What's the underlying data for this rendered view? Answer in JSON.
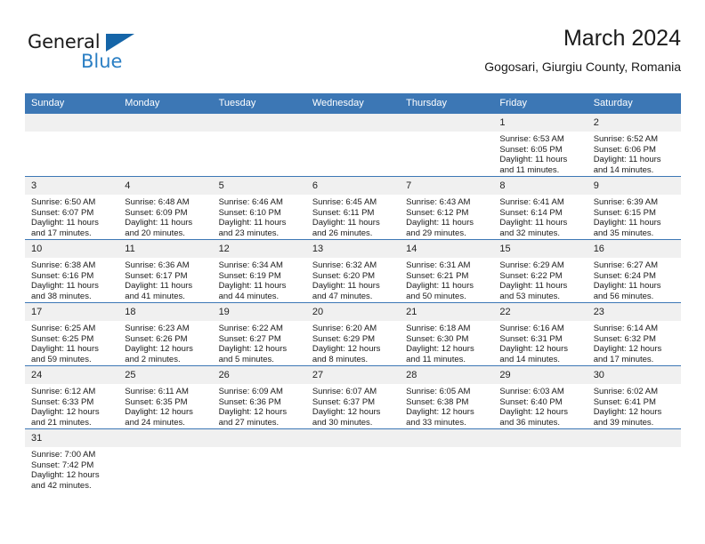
{
  "brand": {
    "name_top": "General",
    "name_bottom": "Blue",
    "accent_color": "#2b7fc4",
    "triangle_color": "#1565a8"
  },
  "header": {
    "title": "March 2024",
    "subtitle": "Gogosari, Giurgiu County, Romania"
  },
  "theme": {
    "header_bg": "#3c77b5",
    "header_text": "#ffffff",
    "daynum_bg": "#f0f0f0",
    "row_border": "#3c77b5"
  },
  "weekday_headers": [
    "Sunday",
    "Monday",
    "Tuesday",
    "Wednesday",
    "Thursday",
    "Friday",
    "Saturday"
  ],
  "labels": {
    "sunrise_prefix": "Sunrise:",
    "sunset_prefix": "Sunset:",
    "daylight_prefix": "Daylight:"
  },
  "weeks": [
    [
      {
        "day": ""
      },
      {
        "day": ""
      },
      {
        "day": ""
      },
      {
        "day": ""
      },
      {
        "day": ""
      },
      {
        "day": "1",
        "sunrise": "Sunrise: 6:53 AM",
        "sunset": "Sunset: 6:05 PM",
        "daylight1": "Daylight: 11 hours",
        "daylight2": "and 11 minutes."
      },
      {
        "day": "2",
        "sunrise": "Sunrise: 6:52 AM",
        "sunset": "Sunset: 6:06 PM",
        "daylight1": "Daylight: 11 hours",
        "daylight2": "and 14 minutes."
      }
    ],
    [
      {
        "day": "3",
        "sunrise": "Sunrise: 6:50 AM",
        "sunset": "Sunset: 6:07 PM",
        "daylight1": "Daylight: 11 hours",
        "daylight2": "and 17 minutes."
      },
      {
        "day": "4",
        "sunrise": "Sunrise: 6:48 AM",
        "sunset": "Sunset: 6:09 PM",
        "daylight1": "Daylight: 11 hours",
        "daylight2": "and 20 minutes."
      },
      {
        "day": "5",
        "sunrise": "Sunrise: 6:46 AM",
        "sunset": "Sunset: 6:10 PM",
        "daylight1": "Daylight: 11 hours",
        "daylight2": "and 23 minutes."
      },
      {
        "day": "6",
        "sunrise": "Sunrise: 6:45 AM",
        "sunset": "Sunset: 6:11 PM",
        "daylight1": "Daylight: 11 hours",
        "daylight2": "and 26 minutes."
      },
      {
        "day": "7",
        "sunrise": "Sunrise: 6:43 AM",
        "sunset": "Sunset: 6:12 PM",
        "daylight1": "Daylight: 11 hours",
        "daylight2": "and 29 minutes."
      },
      {
        "day": "8",
        "sunrise": "Sunrise: 6:41 AM",
        "sunset": "Sunset: 6:14 PM",
        "daylight1": "Daylight: 11 hours",
        "daylight2": "and 32 minutes."
      },
      {
        "day": "9",
        "sunrise": "Sunrise: 6:39 AM",
        "sunset": "Sunset: 6:15 PM",
        "daylight1": "Daylight: 11 hours",
        "daylight2": "and 35 minutes."
      }
    ],
    [
      {
        "day": "10",
        "sunrise": "Sunrise: 6:38 AM",
        "sunset": "Sunset: 6:16 PM",
        "daylight1": "Daylight: 11 hours",
        "daylight2": "and 38 minutes."
      },
      {
        "day": "11",
        "sunrise": "Sunrise: 6:36 AM",
        "sunset": "Sunset: 6:17 PM",
        "daylight1": "Daylight: 11 hours",
        "daylight2": "and 41 minutes."
      },
      {
        "day": "12",
        "sunrise": "Sunrise: 6:34 AM",
        "sunset": "Sunset: 6:19 PM",
        "daylight1": "Daylight: 11 hours",
        "daylight2": "and 44 minutes."
      },
      {
        "day": "13",
        "sunrise": "Sunrise: 6:32 AM",
        "sunset": "Sunset: 6:20 PM",
        "daylight1": "Daylight: 11 hours",
        "daylight2": "and 47 minutes."
      },
      {
        "day": "14",
        "sunrise": "Sunrise: 6:31 AM",
        "sunset": "Sunset: 6:21 PM",
        "daylight1": "Daylight: 11 hours",
        "daylight2": "and 50 minutes."
      },
      {
        "day": "15",
        "sunrise": "Sunrise: 6:29 AM",
        "sunset": "Sunset: 6:22 PM",
        "daylight1": "Daylight: 11 hours",
        "daylight2": "and 53 minutes."
      },
      {
        "day": "16",
        "sunrise": "Sunrise: 6:27 AM",
        "sunset": "Sunset: 6:24 PM",
        "daylight1": "Daylight: 11 hours",
        "daylight2": "and 56 minutes."
      }
    ],
    [
      {
        "day": "17",
        "sunrise": "Sunrise: 6:25 AM",
        "sunset": "Sunset: 6:25 PM",
        "daylight1": "Daylight: 11 hours",
        "daylight2": "and 59 minutes."
      },
      {
        "day": "18",
        "sunrise": "Sunrise: 6:23 AM",
        "sunset": "Sunset: 6:26 PM",
        "daylight1": "Daylight: 12 hours",
        "daylight2": "and 2 minutes."
      },
      {
        "day": "19",
        "sunrise": "Sunrise: 6:22 AM",
        "sunset": "Sunset: 6:27 PM",
        "daylight1": "Daylight: 12 hours",
        "daylight2": "and 5 minutes."
      },
      {
        "day": "20",
        "sunrise": "Sunrise: 6:20 AM",
        "sunset": "Sunset: 6:29 PM",
        "daylight1": "Daylight: 12 hours",
        "daylight2": "and 8 minutes."
      },
      {
        "day": "21",
        "sunrise": "Sunrise: 6:18 AM",
        "sunset": "Sunset: 6:30 PM",
        "daylight1": "Daylight: 12 hours",
        "daylight2": "and 11 minutes."
      },
      {
        "day": "22",
        "sunrise": "Sunrise: 6:16 AM",
        "sunset": "Sunset: 6:31 PM",
        "daylight1": "Daylight: 12 hours",
        "daylight2": "and 14 minutes."
      },
      {
        "day": "23",
        "sunrise": "Sunrise: 6:14 AM",
        "sunset": "Sunset: 6:32 PM",
        "daylight1": "Daylight: 12 hours",
        "daylight2": "and 17 minutes."
      }
    ],
    [
      {
        "day": "24",
        "sunrise": "Sunrise: 6:12 AM",
        "sunset": "Sunset: 6:33 PM",
        "daylight1": "Daylight: 12 hours",
        "daylight2": "and 21 minutes."
      },
      {
        "day": "25",
        "sunrise": "Sunrise: 6:11 AM",
        "sunset": "Sunset: 6:35 PM",
        "daylight1": "Daylight: 12 hours",
        "daylight2": "and 24 minutes."
      },
      {
        "day": "26",
        "sunrise": "Sunrise: 6:09 AM",
        "sunset": "Sunset: 6:36 PM",
        "daylight1": "Daylight: 12 hours",
        "daylight2": "and 27 minutes."
      },
      {
        "day": "27",
        "sunrise": "Sunrise: 6:07 AM",
        "sunset": "Sunset: 6:37 PM",
        "daylight1": "Daylight: 12 hours",
        "daylight2": "and 30 minutes."
      },
      {
        "day": "28",
        "sunrise": "Sunrise: 6:05 AM",
        "sunset": "Sunset: 6:38 PM",
        "daylight1": "Daylight: 12 hours",
        "daylight2": "and 33 minutes."
      },
      {
        "day": "29",
        "sunrise": "Sunrise: 6:03 AM",
        "sunset": "Sunset: 6:40 PM",
        "daylight1": "Daylight: 12 hours",
        "daylight2": "and 36 minutes."
      },
      {
        "day": "30",
        "sunrise": "Sunrise: 6:02 AM",
        "sunset": "Sunset: 6:41 PM",
        "daylight1": "Daylight: 12 hours",
        "daylight2": "and 39 minutes."
      }
    ],
    [
      {
        "day": "31",
        "sunrise": "Sunrise: 7:00 AM",
        "sunset": "Sunset: 7:42 PM",
        "daylight1": "Daylight: 12 hours",
        "daylight2": "and 42 minutes."
      },
      {
        "day": ""
      },
      {
        "day": ""
      },
      {
        "day": ""
      },
      {
        "day": ""
      },
      {
        "day": ""
      },
      {
        "day": ""
      }
    ]
  ]
}
